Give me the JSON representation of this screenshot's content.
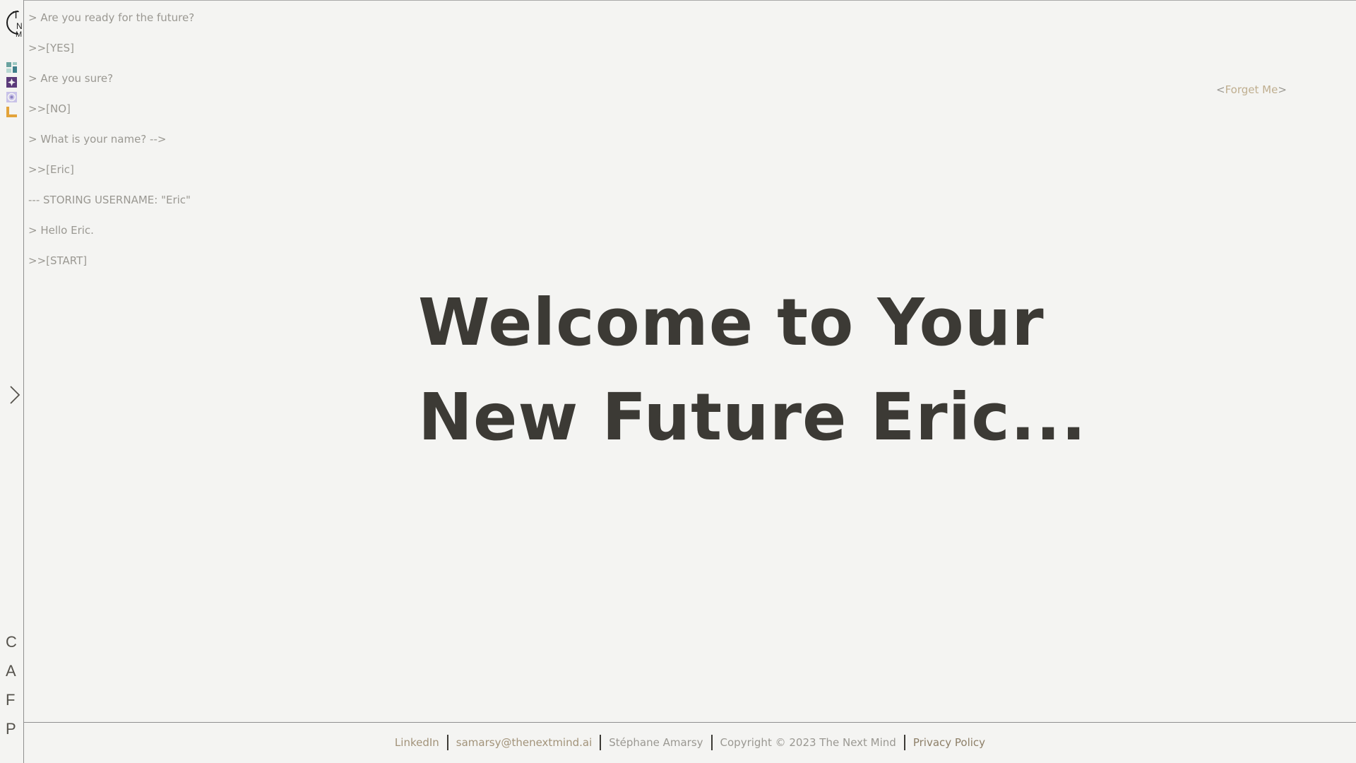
{
  "sidebar": {
    "logo": "TNM",
    "app_icons": [
      {
        "name": "grid-app-icon",
        "color": "#6aa3a0"
      },
      {
        "name": "sparkle-app-icon",
        "color": "#5b3a7a"
      },
      {
        "name": "orbit-app-icon",
        "color": "#b0a8d8"
      },
      {
        "name": "corner-app-icon",
        "color": "#e3a33a"
      }
    ],
    "letters": [
      "C",
      "A",
      "F",
      "P"
    ]
  },
  "terminal": {
    "lines": [
      "> Are you ready for the future?",
      ">>[YES]",
      "> Are you sure?",
      ">>[NO]",
      "> What is your name? -->",
      ">>[Eric]",
      "--- STORING USERNAME: \"Eric\"",
      "> Hello Eric.",
      ">>[START]"
    ]
  },
  "forget_me": {
    "open": "<",
    "label": "Forget Me",
    "close": ">"
  },
  "hero": {
    "line1": "Welcome to Your",
    "line2": "New Future Eric..."
  },
  "footer": {
    "linkedin": "LinkedIn",
    "email": "samarsy@thenextmind.ai",
    "author": "Stéphane Amarsy",
    "copyright": "Copyright © 2023 The Next Mind",
    "privacy": "Privacy Policy"
  }
}
